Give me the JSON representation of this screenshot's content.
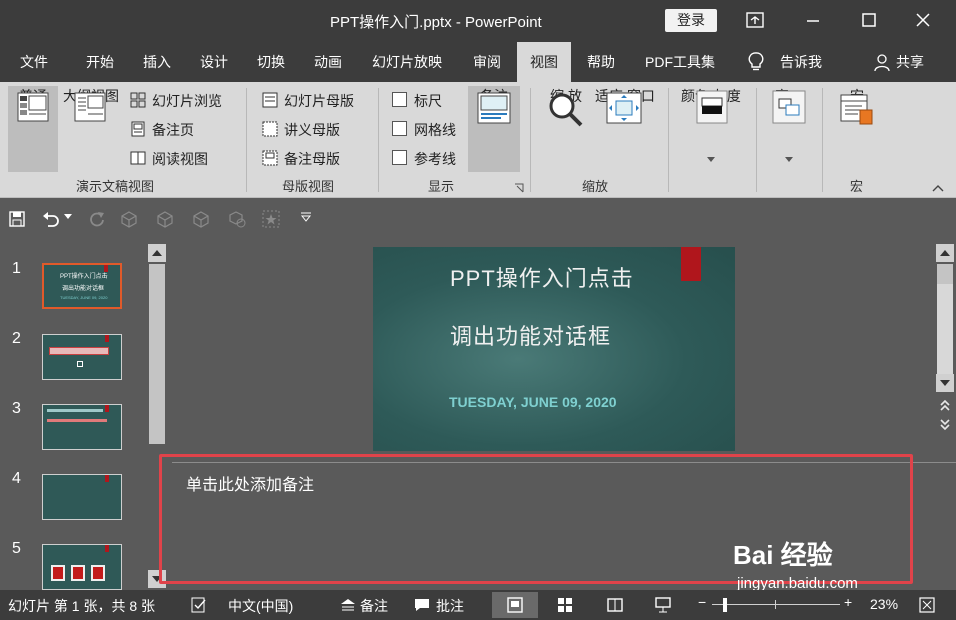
{
  "window": {
    "title": "PPT操作入门.pptx  -  PowerPoint",
    "login_label": "登录"
  },
  "tabs": [
    "文件",
    "开始",
    "插入",
    "设计",
    "切换",
    "动画",
    "幻灯片放映",
    "审阅",
    "视图",
    "帮助",
    "PDF工具集",
    "告诉我",
    "共享"
  ],
  "ribbon": {
    "presentation_views": {
      "label": "演示文稿视图",
      "normal": "普通",
      "outline": "大纲视图",
      "slide_sorter": "幻灯片浏览",
      "notes_page": "备注页",
      "reading_view": "阅读视图"
    },
    "master_views": {
      "label": "母版视图",
      "slide_master": "幻灯片母版",
      "handout_master": "讲义母版",
      "notes_master": "备注母版"
    },
    "show": {
      "label": "显示",
      "ruler": "标尺",
      "gridlines": "网格线",
      "guides": "参考线",
      "notes": "备注"
    },
    "zoom": {
      "label": "缩放",
      "zoom_line1": "缩",
      "zoom_line2": "放",
      "fit_line1": "适应",
      "fit_line2": "窗口大小"
    },
    "color": {
      "label": "颜色/灰度"
    },
    "window": {
      "label": "窗口"
    },
    "macros": {
      "label": "宏",
      "button": "宏"
    }
  },
  "thumbnails": [
    "1",
    "2",
    "3",
    "4",
    "5"
  ],
  "slide": {
    "title_line1": "PPT操作入门点击",
    "title_line2": "调出功能对话框",
    "date": "TUESDAY, JUNE 09, 2020"
  },
  "notes": {
    "placeholder": "单击此处添加备注"
  },
  "thumb1": {
    "line1": "PPT操作入门点击",
    "line2": "调出功能对话框",
    "date": "TUESDAY, JUNE 09, 2020"
  },
  "statusbar": {
    "slide_info": "幻灯片 第 1 张，共 8 张",
    "language": "中文(中国)",
    "notes_label": "备注",
    "comments_label": "批注",
    "zoom_minus": "−",
    "zoom_plus": "+",
    "zoom_value": "23%"
  },
  "watermark": {
    "brand": "Bai 经验",
    "url": "jingyan.baidu.com"
  },
  "colors": {
    "highlight_box": "#e0434a",
    "slide_bg": "#2e5a58",
    "bookmark": "#b0161c",
    "date_text": "#7fd0d0"
  }
}
